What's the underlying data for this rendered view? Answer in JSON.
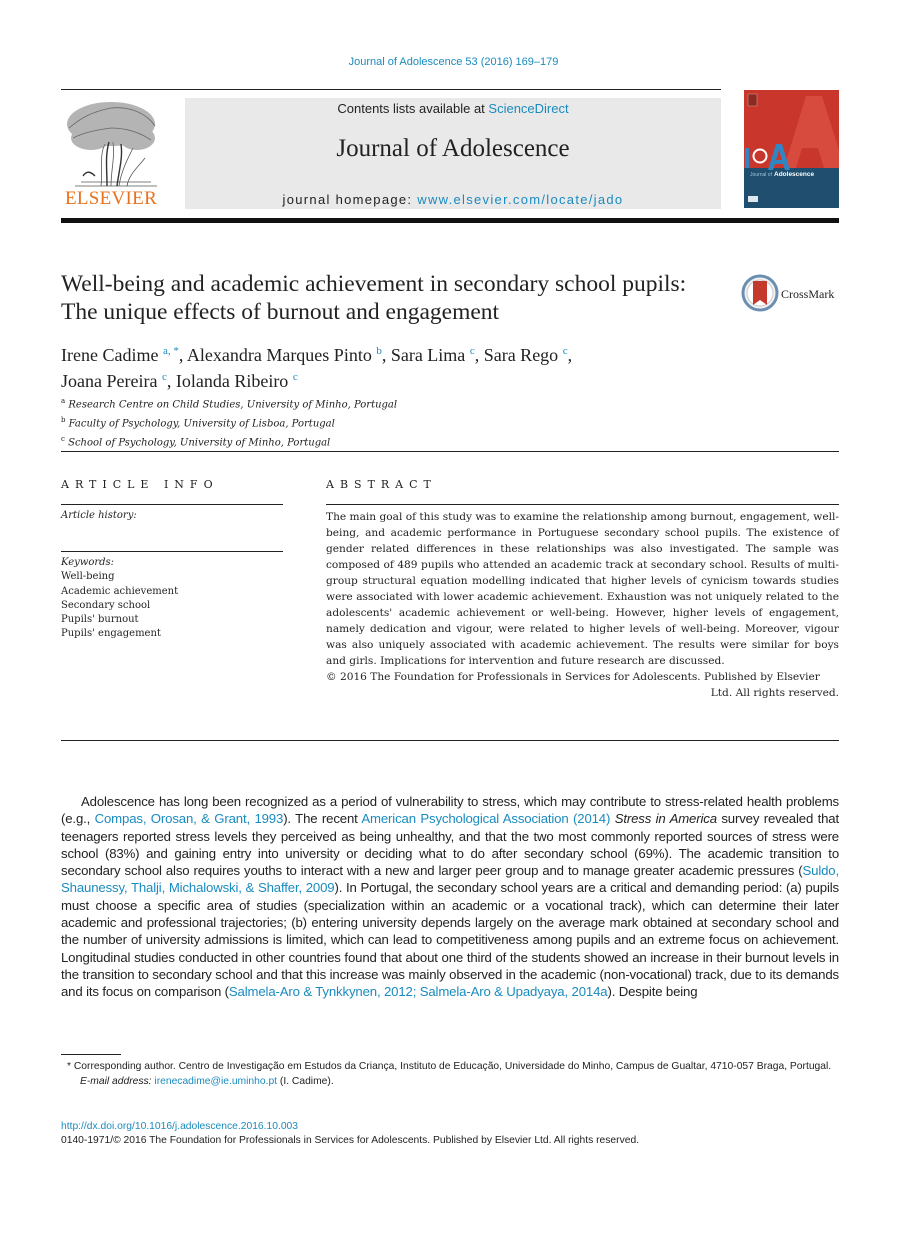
{
  "header": {
    "journal_reference": "Journal of Adolescence 53 (2016) 169–179",
    "contents_prefix": "Contents lists available at ",
    "contents_link": "ScienceDirect",
    "journal_name": "Journal of Adolescence",
    "homepage_prefix": "journal homepage: ",
    "homepage_link": "www.elsevier.com/locate/jado",
    "publisher_logo_text": "ELSEVIER",
    "cover": {
      "letters_jo": "JO",
      "letter_a": "A",
      "caption_prefix": "Journal of ",
      "caption_bold": "Adolescence",
      "colors": {
        "top": "#c9362b",
        "bottom": "#1f4e6e",
        "accent_blue": "#2f86c2"
      }
    }
  },
  "article": {
    "title": "Well-being and academic achievement in secondary school pupils: The unique effects of burnout and engagement",
    "crossmark_label": "CrossMark",
    "authors": [
      {
        "name": "Irene Cadime",
        "sup": "a, *",
        "sep": ", "
      },
      {
        "name": "Alexandra Marques Pinto",
        "sup": "b",
        "sep": ", "
      },
      {
        "name": "Sara Lima",
        "sup": "c",
        "sep": ", "
      },
      {
        "name": "Sara Rego",
        "sup": "c",
        "sep": ","
      },
      {
        "name": "Joana Pereira",
        "sup": "c",
        "sep": ", "
      },
      {
        "name": "Iolanda Ribeiro",
        "sup": "c",
        "sep": ""
      }
    ],
    "affiliations": [
      {
        "key": "a",
        "text": "Research Centre on Child Studies, University of Minho, Portugal"
      },
      {
        "key": "b",
        "text": "Faculty of Psychology, University of Lisboa, Portugal"
      },
      {
        "key": "c",
        "text": "School of Psychology, University of Minho, Portugal"
      }
    ]
  },
  "article_info": {
    "heading": "ARTICLE INFO",
    "history_label": "Article history:",
    "keywords_label": "Keywords:",
    "keywords": [
      "Well-being",
      "Academic achievement",
      "Secondary school",
      "Pupils' burnout",
      "Pupils' engagement"
    ]
  },
  "abstract": {
    "heading": "ABSTRACT",
    "text": "The main goal of this study was to examine the relationship among burnout, engagement, well-being, and academic performance in Portuguese secondary school pupils. The existence of gender related differences in these relationships was also investigated. The sample was composed of 489 pupils who attended an academic track at secondary school. Results of multi-group structural equation modelling indicated that higher levels of cynicism towards studies were associated with lower academic achievement. Exhaustion was not uniquely related to the adolescents' academic achievement or well-being. However, higher levels of engagement, namely dedication and vigour, were related to higher levels of well-being. Moreover, vigour was also uniquely associated with academic achievement. The results were similar for boys and girls. Implications for intervention and future research are discussed.",
    "copyright_line1": "© 2016 The Foundation for Professionals in Services for Adolescents. Published by Elsevier",
    "copyright_line2": "Ltd. All rights reserved."
  },
  "body": {
    "segments": [
      {
        "t": "Adolescence has long been recognized as a period of vulnerability to stress, which may contribute to stress-related health problems (e.g., "
      },
      {
        "link": "Compas, Orosan, & Grant, 1993"
      },
      {
        "t": "). The recent "
      },
      {
        "link": "American Psychological Association (2014)"
      },
      {
        "t": " "
      },
      {
        "italic": "Stress in America"
      },
      {
        "t": " survey revealed that teenagers reported stress levels they perceived as being unhealthy, and that the two most commonly reported sources of stress were school (83%) and gaining entry into university or deciding what to do after secondary school (69%). The academic transition to secondary school also requires youths to interact with a new and larger peer group and to manage greater academic pressures ("
      },
      {
        "link": "Suldo, Shaunessy, Thalji, Michalowski, & Shaffer, 2009"
      },
      {
        "t": "). In Portugal, the secondary school years are a critical and demanding period: (a) pupils must choose a specific area of studies (specialization within an academic or a vocational track), which can determine their later academic and professional trajectories; (b) entering university depends largely on the average mark obtained at secondary school and the number of university admissions is limited, which can lead to competitiveness among pupils and an extreme focus on achievement. Longitudinal studies conducted in other countries found that about one third of the students showed an increase in their burnout levels in the transition to secondary school and that this increase was mainly observed in the academic (non-vocational) track, due to its demands and its focus on comparison ("
      },
      {
        "link": "Salmela-Aro & Tynkkynen, 2012; Salmela-Aro & Upadyaya, 2014a"
      },
      {
        "t": "). Despite being"
      }
    ]
  },
  "footnotes": {
    "corresponding": "* Corresponding author. Centro de Investigação em Estudos da Criança, Instituto de Educação, Universidade do Minho, Campus de Gualtar, 4710-057 Braga, Portugal.",
    "email_label": "E-mail address:",
    "email": "irenecadime@ie.uminho.pt",
    "email_suffix": " (I. Cadime).",
    "doi": "http://dx.doi.org/10.1016/j.adolescence.2016.10.003",
    "issn_copyright": "0140-1971/© 2016 The Foundation for Professionals in Services for Adolescents. Published by Elsevier Ltd. All rights reserved."
  }
}
